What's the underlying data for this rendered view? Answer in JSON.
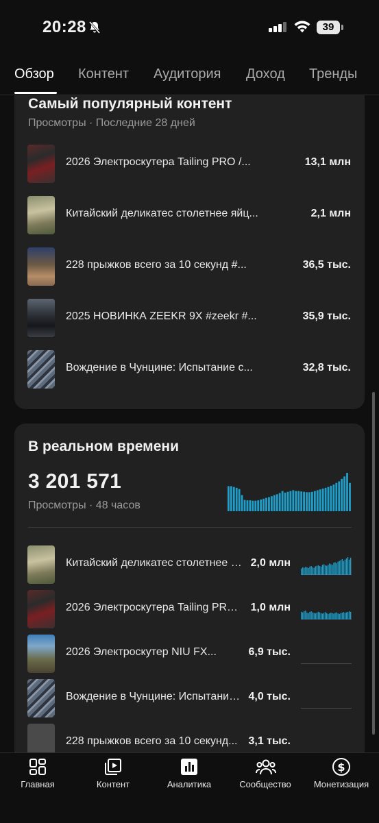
{
  "status_bar": {
    "time": "20:28",
    "battery": "39"
  },
  "tabs": [
    {
      "label": "Обзор",
      "active": true
    },
    {
      "label": "Контент",
      "active": false
    },
    {
      "label": "Аудитория",
      "active": false
    },
    {
      "label": "Доход",
      "active": false
    },
    {
      "label": "Тренды",
      "active": false
    }
  ],
  "top_content": {
    "title": "Самый популярный контент",
    "subtitle": "Просмотры · Последние 28 дней",
    "items": [
      {
        "title": "2026 Электроскутера Tailing PRO /...",
        "value": "13,1 млн"
      },
      {
        "title": "Китайский деликатес столетнее яйц...",
        "value": "2,1 млн"
      },
      {
        "title": "228 прыжков всего за 10 секунд #...",
        "value": "36,5 тыс."
      },
      {
        "title": "2025 НОВИНКА ZEEKR 9X #zeekr #...",
        "value": "35,9 тыс."
      },
      {
        "title": "Вождение в Чунцине: Испытание с...",
        "value": "32,8 тыс."
      }
    ]
  },
  "realtime": {
    "title": "В реальном времени",
    "total": "3 201 571",
    "subtitle": "Просмотры · 48 часов",
    "accent_color": "#1e9ec9",
    "chart_data": {
      "type": "bar",
      "values": [
        62,
        62,
        60,
        58,
        55,
        40,
        28,
        27,
        27,
        26,
        26,
        27,
        29,
        31,
        33,
        35,
        37,
        40,
        42,
        45,
        50,
        46,
        48,
        50,
        52,
        50,
        50,
        49,
        48,
        47,
        47,
        48,
        50,
        52,
        54,
        56,
        58,
        60,
        63,
        66,
        70,
        74,
        80,
        86,
        95,
        70
      ]
    },
    "items": [
      {
        "title": "Китайский деликатес столетнее яйцо...",
        "value": "2,0 млн",
        "spark": [
          25,
          30,
          28,
          32,
          30,
          27,
          33,
          35,
          30,
          28,
          34,
          36,
          38,
          35,
          33,
          40,
          42,
          38,
          36,
          40,
          45,
          42,
          40,
          48,
          50,
          46,
          52,
          55,
          58,
          62,
          55,
          60,
          65,
          70,
          60,
          68
        ]
      },
      {
        "title": "2026 Электроскутера Tailing PRO...",
        "value": "1,0 млн",
        "spark": [
          30,
          28,
          33,
          35,
          27,
          25,
          30,
          32,
          28,
          26,
          24,
          27,
          30,
          28,
          25,
          23,
          26,
          29,
          25,
          22,
          24,
          27,
          25,
          23,
          26,
          28,
          24,
          22,
          25,
          27,
          29,
          26,
          28,
          30,
          32,
          30
        ]
      },
      {
        "title": "2026 Электроскутер NIU FX...",
        "value": "6,9 тыс.",
        "spark": []
      },
      {
        "title": "Вождение в Чунцине: Испытание...",
        "value": "4,0 тыс.",
        "spark": []
      },
      {
        "title": "228 прыжков всего за 10 секунд...",
        "value": "3,1 тыс.",
        "spark": []
      }
    ]
  },
  "bottom_nav": [
    {
      "label": "Главная",
      "icon": "grid-icon"
    },
    {
      "label": "Контент",
      "icon": "video-library-icon"
    },
    {
      "label": "Аналитика",
      "icon": "analytics-icon"
    },
    {
      "label": "Сообщество",
      "icon": "community-icon"
    },
    {
      "label": "Монетизация",
      "icon": "dollar-icon"
    }
  ]
}
